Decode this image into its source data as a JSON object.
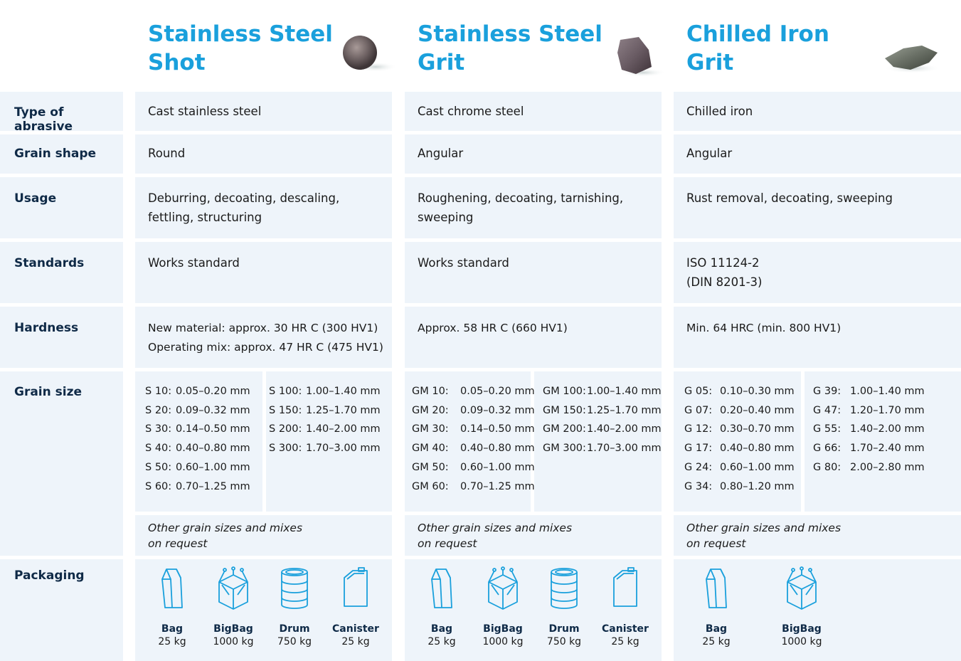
{
  "products": [
    {
      "title_line1": "Stainless Steel",
      "title_line2": "Shot"
    },
    {
      "title_line1": "Stainless Steel",
      "title_line2": "Grit"
    },
    {
      "title_line1": "Chilled Iron",
      "title_line2": "Grit"
    }
  ],
  "rows": {
    "type": {
      "label": "Type of abrasive",
      "values": [
        "Cast stainless steel",
        "Cast chrome steel",
        "Chilled iron"
      ]
    },
    "shape": {
      "label": "Grain shape",
      "values": [
        "Round",
        "Angular",
        "Angular"
      ]
    },
    "usage": {
      "label": "Usage",
      "values": [
        [
          "Deburring, decoating, descaling,",
          "fettling, structuring"
        ],
        [
          "Roughening, decoating, tarnishing,",
          "sweeping"
        ],
        [
          "Rust removal, decoating, sweeping"
        ]
      ]
    },
    "standards": {
      "label": "Standards",
      "values": [
        [
          "Works standard"
        ],
        [
          "Works standard"
        ],
        [
          "ISO 11124-2",
          "(DIN 8201-3)"
        ]
      ]
    },
    "hardness": {
      "label": "Hardness",
      "values": [
        [
          "New material: approx. 30 HR C (300 HV1)",
          "Operating mix: approx. 47 HR C (475 HV1)"
        ],
        [
          "Approx. 58 HR C (660 HV1)"
        ],
        [
          "Min. 64 HRC (min. 800 HV1)"
        ]
      ]
    },
    "grain_size": {
      "label": "Grain size"
    },
    "packaging": {
      "label": "Packaging"
    }
  },
  "grain_sizes": [
    {
      "left": [
        [
          "S 10:",
          "0.05–0.20 mm"
        ],
        [
          "S 20:",
          "0.09–0.32 mm"
        ],
        [
          "S 30:",
          "0.14–0.50 mm"
        ],
        [
          "S 40:",
          "0.40–0.80 mm"
        ],
        [
          "S 50:",
          "0.60–1.00 mm"
        ],
        [
          "S 60:",
          "0.70–1.25 mm"
        ]
      ],
      "right": [
        [
          "S 100:",
          "1.00–1.40 mm"
        ],
        [
          "S 150:",
          "1.25–1.70 mm"
        ],
        [
          "S 200:",
          "1.40–2.00 mm"
        ],
        [
          "S 300:",
          "1.70–3.00 mm"
        ]
      ]
    },
    {
      "left": [
        [
          "GM 10:",
          "0.05–0.20 mm"
        ],
        [
          "GM 20:",
          "0.09–0.32 mm"
        ],
        [
          "GM 30:",
          "0.14–0.50 mm"
        ],
        [
          "GM 40:",
          "0.40–0.80 mm"
        ],
        [
          "GM 50:",
          "0.60–1.00 mm"
        ],
        [
          "GM 60:",
          "0.70–1.25 mm"
        ]
      ],
      "right": [
        [
          "GM 100:",
          "1.00–1.40 mm"
        ],
        [
          "GM 150:",
          "1.25–1.70 mm"
        ],
        [
          "GM 200:",
          "1.40–2.00 mm"
        ],
        [
          "GM 300:",
          "1.70–3.00 mm"
        ]
      ]
    },
    {
      "left": [
        [
          "G 05:",
          "0.10–0.30 mm"
        ],
        [
          "G 07:",
          "0.20–0.40 mm"
        ],
        [
          "G 12:",
          "0.30–0.70 mm"
        ],
        [
          "G 17:",
          "0.40–0.80 mm"
        ],
        [
          "G 24:",
          "0.60–1.00 mm"
        ],
        [
          "G 34:",
          "0.80–1.20 mm"
        ]
      ],
      "right": [
        [
          "G 39:",
          "1.00–1.40 mm"
        ],
        [
          "G 47:",
          "1.20–1.70 mm"
        ],
        [
          "G 55:",
          "1.40–2.00 mm"
        ],
        [
          "G 66:",
          "1.70–2.40 mm"
        ],
        [
          "G 80:",
          "2.00–2.80 mm"
        ]
      ]
    }
  ],
  "note": [
    "Other grain sizes and mixes",
    "on request"
  ],
  "packaging": [
    [
      {
        "icon": "bag-icon",
        "name": "Bag",
        "weight": "25 kg"
      },
      {
        "icon": "bigbag-icon",
        "name": "BigBag",
        "weight": "1000 kg"
      },
      {
        "icon": "drum-icon",
        "name": "Drum",
        "weight": "750 kg"
      },
      {
        "icon": "canister-icon",
        "name": "Canister",
        "weight": "25 kg"
      }
    ],
    [
      {
        "icon": "bag-icon",
        "name": "Bag",
        "weight": "25 kg"
      },
      {
        "icon": "bigbag-icon",
        "name": "BigBag",
        "weight": "1000 kg"
      },
      {
        "icon": "drum-icon",
        "name": "Drum",
        "weight": "750 kg"
      },
      {
        "icon": "canister-icon",
        "name": "Canister",
        "weight": "25 kg"
      }
    ],
    [
      {
        "icon": "bag-icon",
        "name": "Bag",
        "weight": "25 kg"
      },
      {
        "icon": "bigbag-icon",
        "name": "BigBag",
        "weight": "1000 kg"
      }
    ]
  ],
  "colors": {
    "title": "#1aa0dc",
    "cell_bg": "#eef4fa",
    "label": "#0f2a47",
    "icon": "#1aa0dc"
  }
}
